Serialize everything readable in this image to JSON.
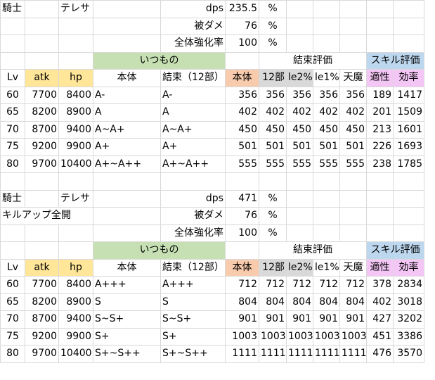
{
  "blocks": [
    {
      "role": "騎士",
      "name": "テレサ",
      "subtitle": "",
      "params": [
        {
          "label": "dps",
          "value": "235.5",
          "unit": "%"
        },
        {
          "label": "被ダメ",
          "value": "76",
          "unit": "%"
        },
        {
          "label": "全体強化率",
          "value": "100",
          "unit": "%"
        }
      ],
      "group_headers": {
        "itsumono": "いつもの",
        "kessoku_hyouka": "結束評価",
        "skill_hyouka": "スキル評価"
      },
      "headers": [
        "Lv",
        "atk",
        "hp",
        "本体",
        "結束（12部）",
        "本体",
        "12部",
        "le2%",
        "le1%",
        "天魔",
        "適性",
        "効率"
      ],
      "rows": [
        [
          "60",
          "7700",
          "8400",
          "A-",
          "A-",
          "356",
          "356",
          "356",
          "356",
          "356",
          "189",
          "1417"
        ],
        [
          "65",
          "8200",
          "8900",
          "A",
          "A",
          "402",
          "402",
          "402",
          "402",
          "402",
          "201",
          "1509"
        ],
        [
          "70",
          "8700",
          "9400",
          "A~A+",
          "A~A+",
          "450",
          "450",
          "450",
          "450",
          "450",
          "213",
          "1601"
        ],
        [
          "75",
          "9200",
          "9900",
          "A+",
          "A+",
          "501",
          "501",
          "501",
          "501",
          "501",
          "226",
          "1693"
        ],
        [
          "80",
          "9700",
          "10400",
          "A+~A++",
          "A+~A++",
          "555",
          "555",
          "555",
          "555",
          "555",
          "238",
          "1785"
        ]
      ]
    },
    {
      "role": "騎士",
      "name": "テレサ",
      "subtitle": "キルアップ全開",
      "params": [
        {
          "label": "dps",
          "value": "471",
          "unit": "%"
        },
        {
          "label": "被ダメ",
          "value": "76",
          "unit": "%"
        },
        {
          "label": "全体強化率",
          "value": "100",
          "unit": "%"
        }
      ],
      "group_headers": {
        "itsumono": "いつもの",
        "kessoku_hyouka": "結束評価",
        "skill_hyouka": "スキル評価"
      },
      "headers": [
        "Lv",
        "atk",
        "hp",
        "本体",
        "結束（12部）",
        "本体",
        "12部",
        "le2%",
        "le1%",
        "天魔",
        "適性",
        "効率"
      ],
      "rows": [
        [
          "60",
          "7700",
          "8400",
          "A+++",
          "A+++",
          "712",
          "712",
          "712",
          "712",
          "712",
          "378",
          "2834"
        ],
        [
          "65",
          "8200",
          "8900",
          "S",
          "S",
          "804",
          "804",
          "804",
          "804",
          "804",
          "402",
          "3018"
        ],
        [
          "70",
          "8700",
          "9400",
          "S~S+",
          "S~S+",
          "901",
          "901",
          "901",
          "901",
          "901",
          "427",
          "3202"
        ],
        [
          "75",
          "9200",
          "9900",
          "S+",
          "S+",
          "1003",
          "1003",
          "1003",
          "1003",
          "1003",
          "451",
          "3386"
        ],
        [
          "80",
          "9700",
          "10400",
          "S+~S++",
          "S+~S++",
          "1111",
          "1111",
          "1111",
          "1111",
          "1111",
          "476",
          "3570"
        ]
      ]
    }
  ],
  "colors": {
    "green": "#c6e0b4",
    "yellow": "#ffe699",
    "orange": "#f8cbad",
    "gray": "#d9d9d9",
    "blue": "#bdd7ee",
    "pink": "#f4c6f6"
  }
}
